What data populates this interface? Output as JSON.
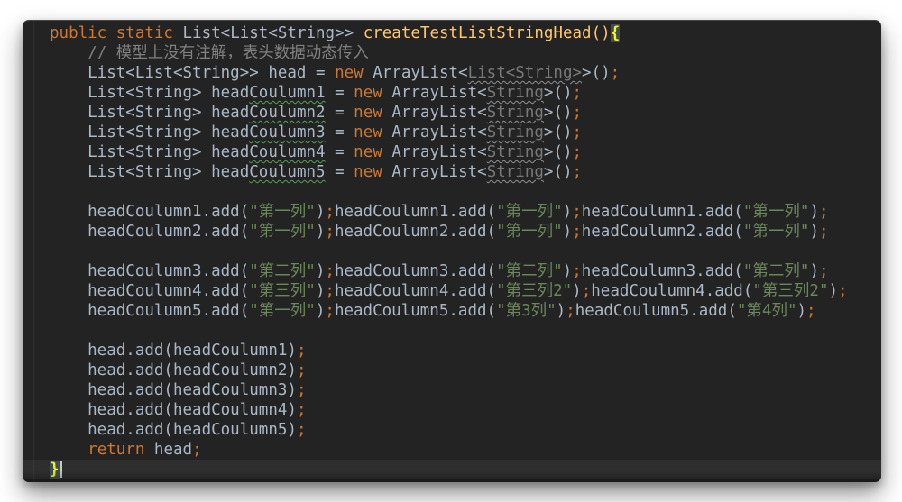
{
  "editor": {
    "colors": {
      "pageBackground": "#ffffff",
      "background": "#232323",
      "currentLine": "#2e2e2e",
      "default": "#a9b7c6",
      "keyword": "#cc7832",
      "method": "#ffc66d",
      "string": "#6a8759",
      "comment": "#808080",
      "dim": "#787878",
      "braceText": "#ffef28",
      "braceBg": "#3b514d",
      "typoSquiggle": "#55a158",
      "warnSquiggle": "#909090",
      "caret": "#c8c8c8"
    },
    "current_line_index": 22,
    "lines": [
      [
        [
          "public static ",
          "kw"
        ],
        [
          "List<List<String>> ",
          "def"
        ],
        [
          "createTestListStringHead",
          "mname"
        ],
        [
          "()",
          "mname"
        ],
        [
          "{",
          "brace"
        ]
      ],
      [
        [
          "    ",
          "def"
        ],
        [
          "// 模型上没有注解，表头数据动态传入",
          "com"
        ]
      ],
      [
        [
          "    List<List<String>> head = ",
          "def"
        ],
        [
          "new ",
          "kw"
        ],
        [
          "ArrayList<",
          "def"
        ],
        [
          "List<String>",
          "dimu"
        ],
        [
          ">()",
          "def"
        ],
        [
          ";",
          "kw"
        ]
      ],
      [
        [
          "    List<String> head",
          "def"
        ],
        [
          "Coulumn1",
          "typo"
        ],
        [
          " = ",
          "def"
        ],
        [
          "new ",
          "kw"
        ],
        [
          "ArrayList<",
          "def"
        ],
        [
          "String",
          "dimu"
        ],
        [
          ">()",
          "def"
        ],
        [
          ";",
          "kw"
        ]
      ],
      [
        [
          "    List<String> head",
          "def"
        ],
        [
          "Coulumn2",
          "typo"
        ],
        [
          " = ",
          "def"
        ],
        [
          "new ",
          "kw"
        ],
        [
          "ArrayList<",
          "def"
        ],
        [
          "String",
          "dimu"
        ],
        [
          ">()",
          "def"
        ],
        [
          ";",
          "kw"
        ]
      ],
      [
        [
          "    List<String> head",
          "def"
        ],
        [
          "Coulumn3",
          "typo"
        ],
        [
          " = ",
          "def"
        ],
        [
          "new ",
          "kw"
        ],
        [
          "ArrayList<",
          "def"
        ],
        [
          "String",
          "dimu"
        ],
        [
          ">()",
          "def"
        ],
        [
          ";",
          "kw"
        ]
      ],
      [
        [
          "    List<String> head",
          "def"
        ],
        [
          "Coulumn4",
          "typo"
        ],
        [
          " = ",
          "def"
        ],
        [
          "new ",
          "kw"
        ],
        [
          "ArrayList<",
          "def"
        ],
        [
          "String",
          "dimu"
        ],
        [
          ">()",
          "def"
        ],
        [
          ";",
          "kw"
        ]
      ],
      [
        [
          "    List<String> head",
          "def"
        ],
        [
          "Coulumn5",
          "typo"
        ],
        [
          " = ",
          "def"
        ],
        [
          "new ",
          "kw"
        ],
        [
          "ArrayList<",
          "def"
        ],
        [
          "String",
          "dimu"
        ],
        [
          ">()",
          "def"
        ],
        [
          ";",
          "kw"
        ]
      ],
      [],
      [
        [
          "    headCoulumn1.add(",
          "def"
        ],
        [
          "\"第一列\"",
          "str"
        ],
        [
          ")",
          "def"
        ],
        [
          ";",
          "kw"
        ],
        [
          "headCoulumn1.add(",
          "def"
        ],
        [
          "\"第一列\"",
          "str"
        ],
        [
          ")",
          "def"
        ],
        [
          ";",
          "kw"
        ],
        [
          "headCoulumn1.add(",
          "def"
        ],
        [
          "\"第一列\"",
          "str"
        ],
        [
          ")",
          "def"
        ],
        [
          ";",
          "kw"
        ]
      ],
      [
        [
          "    headCoulumn2.add(",
          "def"
        ],
        [
          "\"第一列\"",
          "str"
        ],
        [
          ")",
          "def"
        ],
        [
          ";",
          "kw"
        ],
        [
          "headCoulumn2.add(",
          "def"
        ],
        [
          "\"第一列\"",
          "str"
        ],
        [
          ")",
          "def"
        ],
        [
          ";",
          "kw"
        ],
        [
          "headCoulumn2.add(",
          "def"
        ],
        [
          "\"第一列\"",
          "str"
        ],
        [
          ")",
          "def"
        ],
        [
          ";",
          "kw"
        ]
      ],
      [],
      [
        [
          "    headCoulumn3.add(",
          "def"
        ],
        [
          "\"第二列\"",
          "str"
        ],
        [
          ")",
          "def"
        ],
        [
          ";",
          "kw"
        ],
        [
          "headCoulumn3.add(",
          "def"
        ],
        [
          "\"第二列\"",
          "str"
        ],
        [
          ")",
          "def"
        ],
        [
          ";",
          "kw"
        ],
        [
          "headCoulumn3.add(",
          "def"
        ],
        [
          "\"第二列\"",
          "str"
        ],
        [
          ")",
          "def"
        ],
        [
          ";",
          "kw"
        ]
      ],
      [
        [
          "    headCoulumn4.add(",
          "def"
        ],
        [
          "\"第三列\"",
          "str"
        ],
        [
          ")",
          "def"
        ],
        [
          ";",
          "kw"
        ],
        [
          "headCoulumn4.add(",
          "def"
        ],
        [
          "\"第三列2\"",
          "str"
        ],
        [
          ")",
          "def"
        ],
        [
          ";",
          "kw"
        ],
        [
          "headCoulumn4.add(",
          "def"
        ],
        [
          "\"第三列2\"",
          "str"
        ],
        [
          ")",
          "def"
        ],
        [
          ";",
          "kw"
        ]
      ],
      [
        [
          "    headCoulumn5.add(",
          "def"
        ],
        [
          "\"第一列\"",
          "str"
        ],
        [
          ")",
          "def"
        ],
        [
          ";",
          "kw"
        ],
        [
          "headCoulumn5.add(",
          "def"
        ],
        [
          "\"第3列\"",
          "str"
        ],
        [
          ")",
          "def"
        ],
        [
          ";",
          "kw"
        ],
        [
          "headCoulumn5.add(",
          "def"
        ],
        [
          "\"第4列\"",
          "str"
        ],
        [
          ")",
          "def"
        ],
        [
          ";",
          "kw"
        ]
      ],
      [],
      [
        [
          "    head.add(headCoulumn1)",
          "def"
        ],
        [
          ";",
          "kw"
        ]
      ],
      [
        [
          "    head.add(headCoulumn2)",
          "def"
        ],
        [
          ";",
          "kw"
        ]
      ],
      [
        [
          "    head.add(headCoulumn3)",
          "def"
        ],
        [
          ";",
          "kw"
        ]
      ],
      [
        [
          "    head.add(headCoulumn4)",
          "def"
        ],
        [
          ";",
          "kw"
        ]
      ],
      [
        [
          "    head.add(headCoulumn5)",
          "def"
        ],
        [
          ";",
          "kw"
        ]
      ],
      [
        [
          "    ",
          "def"
        ],
        [
          "return ",
          "kw"
        ],
        [
          "head",
          "def"
        ],
        [
          ";",
          "kw"
        ]
      ],
      [
        [
          "}",
          "brace"
        ],
        [
          "",
          "caret"
        ]
      ]
    ]
  }
}
